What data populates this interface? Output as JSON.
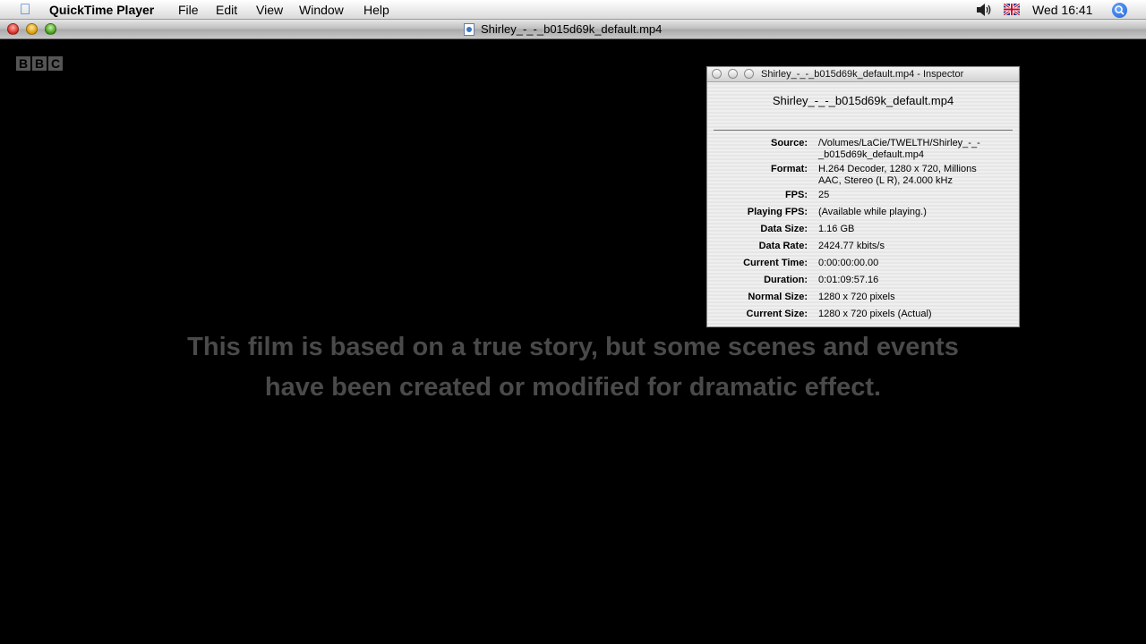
{
  "menubar": {
    "app_name": "QuickTime Player",
    "items": [
      "File",
      "Edit",
      "View",
      "Window",
      "Help"
    ],
    "clock": "Wed 16:41"
  },
  "movie_window": {
    "title": "Shirley_-_-_b015d69k_default.mp4"
  },
  "video": {
    "logo_letters": [
      "B",
      "B",
      "C"
    ],
    "caption_line1": "This film is based on a true story, but some scenes and events",
    "caption_line2": "have been created or modified for dramatic effect."
  },
  "inspector": {
    "title": "Shirley_-_-_b015d69k_default.mp4 - Inspector",
    "header": "Shirley_-_-_b015d69k_default.mp4",
    "rows": [
      {
        "label": "Source:",
        "value1": "/Volumes/LaCie/TWELTH/Shirley_-_-",
        "value2": "_b015d69k_default.mp4"
      },
      {
        "label": "Format:",
        "value1": "H.264 Decoder, 1280 x 720, Millions",
        "value2": "AAC, Stereo (L R), 24.000 kHz"
      },
      {
        "label": "FPS:",
        "value1": "25"
      },
      {
        "label": "Playing FPS:",
        "value1": "(Available while playing.)"
      },
      {
        "label": "Data Size:",
        "value1": "1.16 GB"
      },
      {
        "label": "Data Rate:",
        "value1": "2424.77 kbits/s"
      },
      {
        "label": "Current Time:",
        "value1": "0:00:00:00.00"
      },
      {
        "label": "Duration:",
        "value1": "0:01:09:57.16"
      },
      {
        "label": "Normal Size:",
        "value1": "1280 x 720 pixels"
      },
      {
        "label": "Current Size:",
        "value1": "1280 x 720 pixels (Actual)"
      }
    ]
  },
  "colors": {
    "spotlight": "#1f5fd0",
    "apple": "#2a74d6"
  }
}
